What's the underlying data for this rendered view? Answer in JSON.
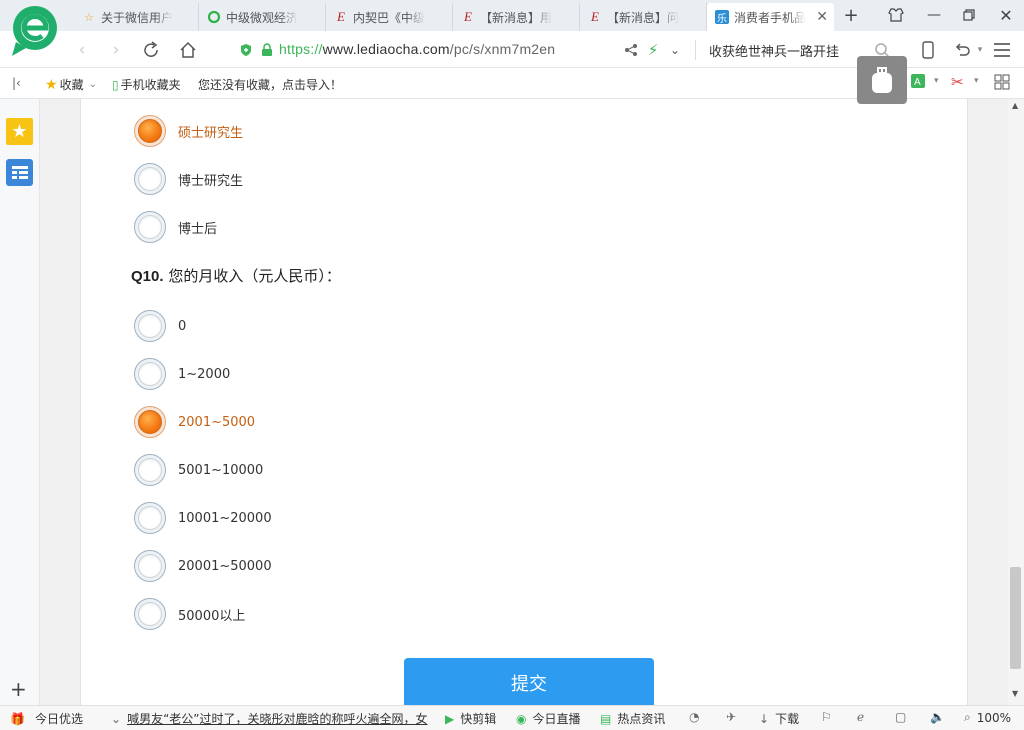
{
  "tabs": [
    {
      "label": "关于微信用户",
      "icon": "star-icon"
    },
    {
      "label": "中级微观经济",
      "icon": "search-logo-icon"
    },
    {
      "label": "内契巴《中级",
      "icon": "e-logo-icon"
    },
    {
      "label": "【新消息】用",
      "icon": "e-logo-icon"
    },
    {
      "label": "【新消息】问",
      "icon": "e-logo-icon"
    },
    {
      "label": "消费者手机品",
      "icon": "site-icon",
      "active": true
    }
  ],
  "address": {
    "scheme": "https://",
    "host": "www.lediaocha.com",
    "path": "/pc/s/xnm7m2en"
  },
  "search_hint": "收获绝世神兵一路开挂",
  "bookmarks": {
    "favorites_label": "收藏",
    "mobile_label": "手机收藏夹",
    "empty_hint": "您还没有收藏，点击导入！"
  },
  "survey": {
    "prev_options": [
      {
        "label": "硕士研究生",
        "selected": true
      },
      {
        "label": "博士研究生",
        "selected": false
      },
      {
        "label": "博士后",
        "selected": false
      }
    ],
    "q10": {
      "number": "Q10.",
      "title": "您的月收入（元人民币）：",
      "options": [
        {
          "label": "0",
          "selected": false
        },
        {
          "label": "1~2000",
          "selected": false
        },
        {
          "label": "2001~5000",
          "selected": true
        },
        {
          "label": "5001~10000",
          "selected": false
        },
        {
          "label": "10001~20000",
          "selected": false
        },
        {
          "label": "20001~50000",
          "selected": false
        },
        {
          "label": "50000以上",
          "selected": false
        }
      ]
    },
    "submit_label": "提交"
  },
  "statusbar": {
    "today_pick": "今日优选",
    "news": "喊男友“老公”过时了，关晓彤对鹿晗的称呼火遍全网，女",
    "quick_edit": "快剪辑",
    "live": "今日直播",
    "hot_news": "热点资讯",
    "download": "下载",
    "zoom": "100%"
  },
  "colors": {
    "accent": "#2d9cf0",
    "selected_radio": "#f57c14",
    "selected_text": "#c45f13"
  }
}
